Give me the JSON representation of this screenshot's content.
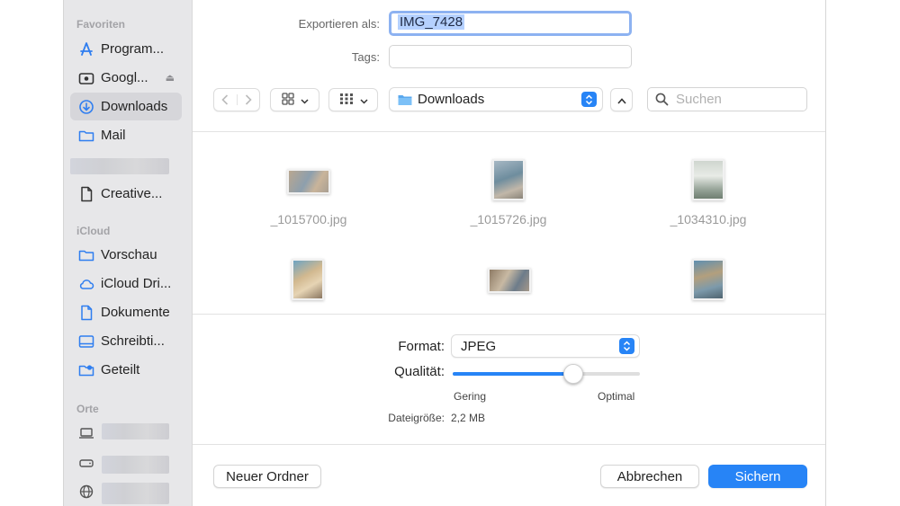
{
  "sidebar": {
    "favorites_header": "Favoriten",
    "favorites": [
      {
        "label": "Program...",
        "icon": "applications-icon"
      },
      {
        "label": "Googl...",
        "icon": "drive-icon",
        "eject": "⏏"
      },
      {
        "label": "Downloads",
        "icon": "downloads-icon",
        "active": true
      },
      {
        "label": "Mail",
        "icon": "folder-icon"
      },
      {
        "label": "Creative...",
        "icon": "document-icon"
      }
    ],
    "icloud_header": "iCloud",
    "icloud": [
      {
        "label": "Vorschau",
        "icon": "folder-icon"
      },
      {
        "label": "iCloud Dri...",
        "icon": "cloud-icon"
      },
      {
        "label": "Dokumente",
        "icon": "document-icon"
      },
      {
        "label": "Schreibti...",
        "icon": "desktop-icon"
      },
      {
        "label": "Geteilt",
        "icon": "shared-folder-icon"
      }
    ],
    "places_header": "Orte"
  },
  "export": {
    "label": "Exportieren als:",
    "value": "IMG_7428",
    "tags_label": "Tags:",
    "tags_value": ""
  },
  "toolbar": {
    "location": "Downloads",
    "search_placeholder": "Suchen"
  },
  "files": [
    {
      "name": "_1015700.jpg"
    },
    {
      "name": "_1015726.jpg"
    },
    {
      "name": "_1034310.jpg"
    },
    {
      "name": ""
    },
    {
      "name": ""
    },
    {
      "name": ""
    }
  ],
  "options": {
    "format_label": "Format:",
    "format_value": "JPEG",
    "quality_label": "Qualität:",
    "quality_level": 0.66,
    "quality_min": "Gering",
    "quality_max": "Optimal",
    "filesize_label": "Dateigröße:",
    "filesize_value": "2,2 MB"
  },
  "buttons": {
    "new_folder": "Neuer Ordner",
    "cancel": "Abbrechen",
    "save": "Sichern"
  },
  "colors": {
    "accent": "#2784f6",
    "focus_ring": "#8db2f1",
    "sidebar_bg": "#e7e7e9"
  }
}
